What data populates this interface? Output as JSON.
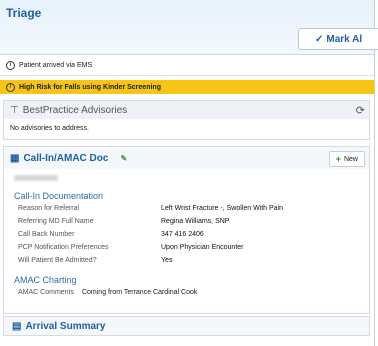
{
  "header": {
    "title": "Triage",
    "mark_label": "Mark Al"
  },
  "notices": {
    "arrived": "Patient arrived via EMS",
    "falls": "High Risk for Falls using Kinder Screening"
  },
  "bpa": {
    "title": "BestPractice Advisories",
    "body": "No advisories to address."
  },
  "calldoc": {
    "title": "Call-In/AMAC Doc",
    "new_label": "New",
    "section_title": "Call-In Documentation",
    "fields": [
      {
        "label": "Reason for Referral",
        "value": "Left Wrist Fracture -, Swollen With Pain"
      },
      {
        "label": "Referring MD Full Name",
        "value": "Regina Williams, SNP"
      },
      {
        "label": "Call Back Number",
        "value": "347 416 2406"
      },
      {
        "label": "PCP Notification Preferences",
        "value": "Upon Physician Encounter"
      },
      {
        "label": "Will Patient Be Admitted?",
        "value": "Yes"
      }
    ],
    "amac_title": "AMAC Charting",
    "amac_label": "AMAC Comments",
    "amac_value": "Coming from Terrance Cardinal Cook"
  },
  "arrival": {
    "title": "Arrival Summary"
  }
}
